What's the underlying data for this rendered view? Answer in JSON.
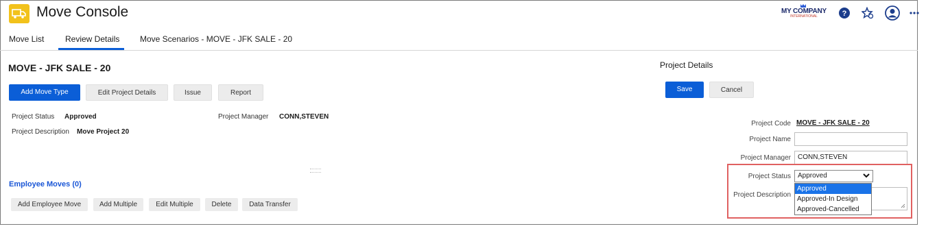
{
  "app": {
    "title": "Move Console"
  },
  "header": {
    "company_line1": "MY COMPANY",
    "company_line2": "INTERNATIONAL",
    "icons": [
      "help-icon",
      "favorite-settings-icon",
      "user-avatar-icon",
      "more-icon"
    ]
  },
  "tabs": [
    {
      "label": "Move List"
    },
    {
      "label": "Review Details"
    },
    {
      "label": "Move Scenarios - MOVE - JFK SALE - 20"
    }
  ],
  "project": {
    "title": "MOVE - JFK SALE - 20",
    "buttons": {
      "add_move_type": "Add Move Type",
      "edit_details": "Edit Project Details",
      "issue": "Issue",
      "report": "Report"
    },
    "status_label": "Project Status",
    "status_value": "Approved",
    "manager_label": "Project Manager",
    "manager_value": "CONN,STEVEN",
    "description_label": "Project Description",
    "description_value": "Move Project 20"
  },
  "employee_moves": {
    "title": "Employee Moves (0)",
    "buttons": {
      "add_employee_move": "Add Employee Move",
      "add_multiple": "Add Multiple",
      "edit_multiple": "Edit Multiple",
      "delete": "Delete",
      "data_transfer": "Data Transfer"
    }
  },
  "project_details": {
    "title": "Project Details",
    "save": "Save",
    "cancel": "Cancel",
    "code_label": "Project Code",
    "code_value": "MOVE - JFK SALE - 20",
    "name_label": "Project Name",
    "name_value": "",
    "manager_label": "Project Manager",
    "manager_value": "CONN,STEVEN",
    "status_label": "Project Status",
    "status_value": "Approved",
    "description_label": "Project Description",
    "status_options": [
      "Approved",
      "Approved-In Design",
      "Approved-Cancelled"
    ]
  },
  "colors": {
    "primary": "#0b5ed7",
    "logo": "#f2c21b",
    "link": "#1a56d6",
    "highlight": "#e06060",
    "selected_option": "#1a73e8"
  }
}
